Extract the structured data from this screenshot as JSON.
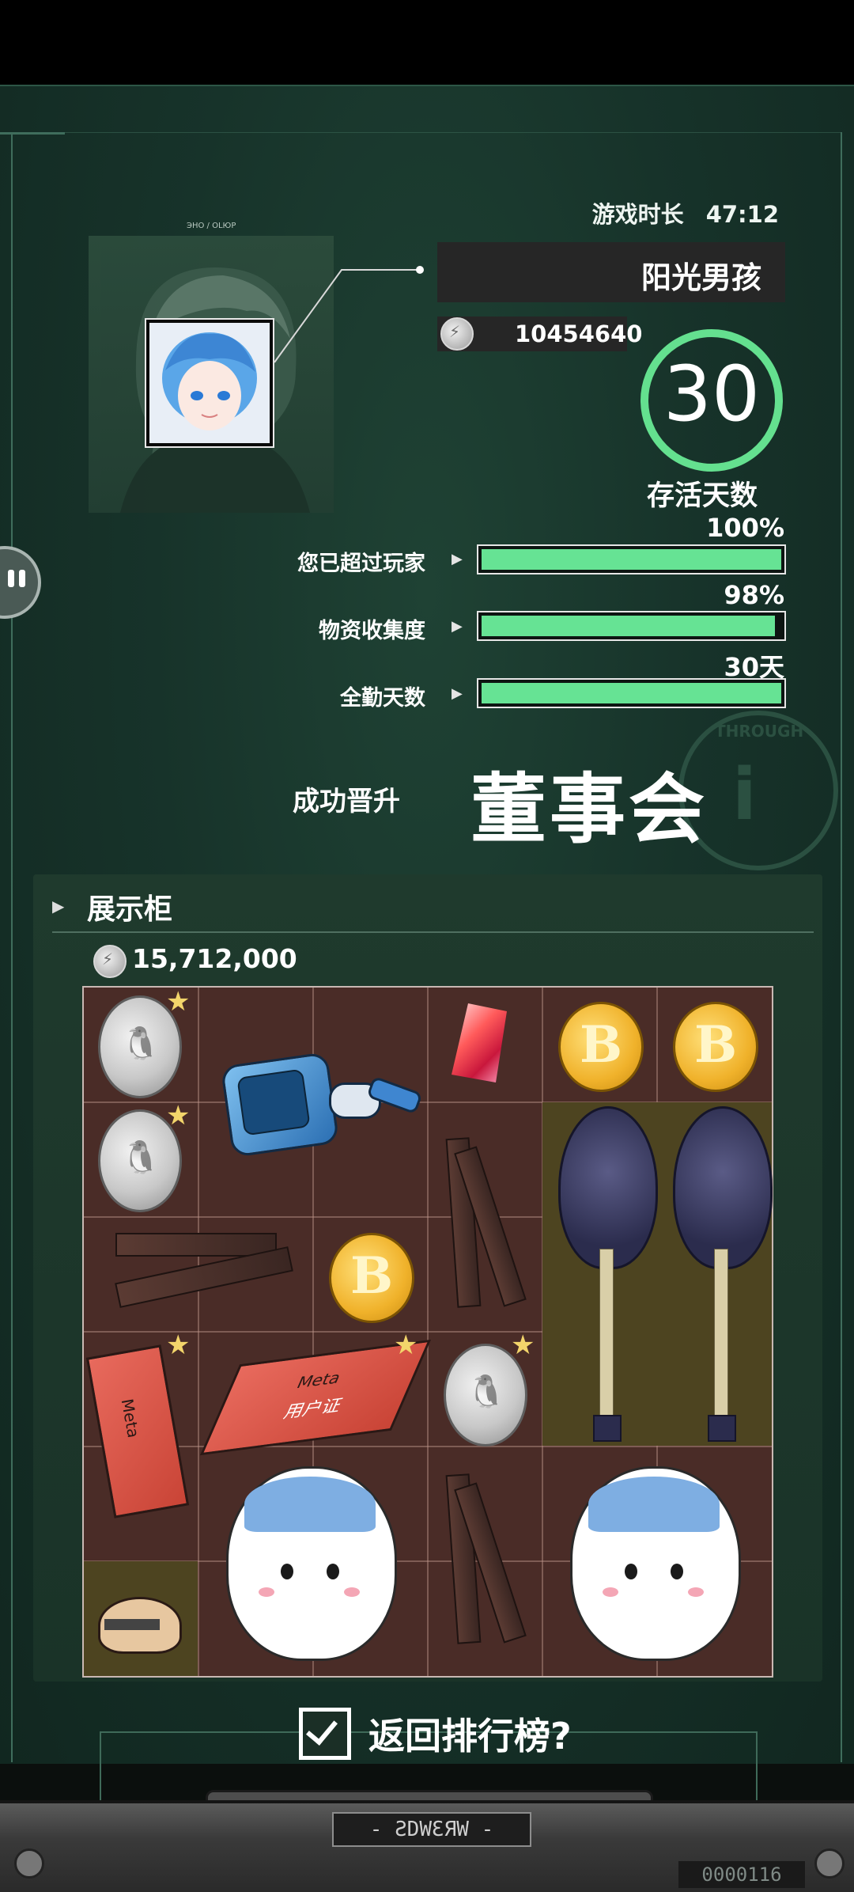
{
  "header": {
    "play_time_label": "游戏时长",
    "play_time_value": "47:12"
  },
  "player": {
    "name": "阳光男孩",
    "coins": "10454640",
    "portrait_caption": "ЭНО / ОLЮР"
  },
  "survival": {
    "days": "30",
    "label": "存活天数"
  },
  "stats": [
    {
      "label": "您已超过玩家",
      "value": "100%",
      "progress": 1.0
    },
    {
      "label": "物资收集度",
      "value": "98%",
      "progress": 0.98
    },
    {
      "label": "全勤天数",
      "value": "30天",
      "progress": 1.0
    }
  ],
  "promotion": {
    "label": "成功晋升",
    "title": "董事会"
  },
  "stamp": {
    "text": "THROUGH"
  },
  "showcase": {
    "title": "展示柜",
    "total": "15,712,000",
    "items": [
      {
        "name": "silver-coin",
        "starred": true
      },
      {
        "name": "robot-drone",
        "starred": false
      },
      {
        "name": "red-crystal",
        "starred": false
      },
      {
        "name": "bitcoin",
        "starred": false
      },
      {
        "name": "bitcoin",
        "starred": false
      },
      {
        "name": "silver-coin",
        "starred": true
      },
      {
        "name": "wooden-stick",
        "starred": false
      },
      {
        "name": "bass-guitar",
        "starred": false
      },
      {
        "name": "bass-guitar",
        "starred": false
      },
      {
        "name": "wooden-sticks-pair",
        "starred": false
      },
      {
        "name": "bitcoin",
        "starred": false
      },
      {
        "name": "meta-card",
        "starred": true
      },
      {
        "name": "meta-card",
        "starred": true
      },
      {
        "name": "silver-coin",
        "starred": true
      },
      {
        "name": "chiikawa-cat",
        "starred": false
      },
      {
        "name": "wooden-stick",
        "starred": false
      },
      {
        "name": "chiikawa-cat",
        "starred": false
      },
      {
        "name": "helmet",
        "starred": false
      }
    ],
    "card_text": "Meta",
    "card_sub": "用户证",
    "coin_mark": "B"
  },
  "footer": {
    "return_label": "返回排行榜?",
    "console_label": "- ƧDWƐЯW -",
    "console_counter": "0000116"
  },
  "colors": {
    "accent": "#66e394",
    "panel": "#17332a",
    "grid": "#4a2c27"
  }
}
